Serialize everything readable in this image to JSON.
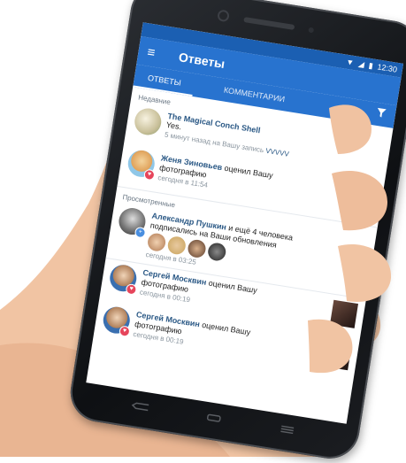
{
  "status_bar": {
    "time": "12:30"
  },
  "toolbar": {
    "title": "Ответы"
  },
  "tabs": [
    {
      "label": "ОТВЕТЫ",
      "active": true
    },
    {
      "label": "КОММЕНТАРИИ",
      "active": false
    }
  ],
  "sections": {
    "recent": "Недавние",
    "viewed": "Просмотренные"
  },
  "items": [
    {
      "name": "The Magical Conch Shell",
      "text": "Yes.",
      "meta_prefix": "5 минут назад на Вашу запись ",
      "meta_link": "VVVVV"
    },
    {
      "name": "Женя Зиновьев",
      "action": " оценил Вашу",
      "object": "фотографию",
      "meta": "сегодня в 11:54"
    },
    {
      "name": "Александр Пушкин",
      "action": " и ещё 4 человека",
      "action2": "подписались на Ваши обновления",
      "meta": "сегодня в 03:25"
    },
    {
      "name": "Сергей Москвин",
      "action": " оценил Вашу",
      "object": "фотографию",
      "meta": "сегодня в 00:19"
    },
    {
      "name": "Сергей Москвин",
      "action": " оценил Вашу",
      "object": "фотографию",
      "meta": "сегодня в 00:19"
    }
  ],
  "colors": {
    "toolbar": "#2873cf",
    "statusbar": "#1b5fb2",
    "link": "#2a5885",
    "like_badge": "#e6455b",
    "follow_badge": "#4a8fe0"
  }
}
